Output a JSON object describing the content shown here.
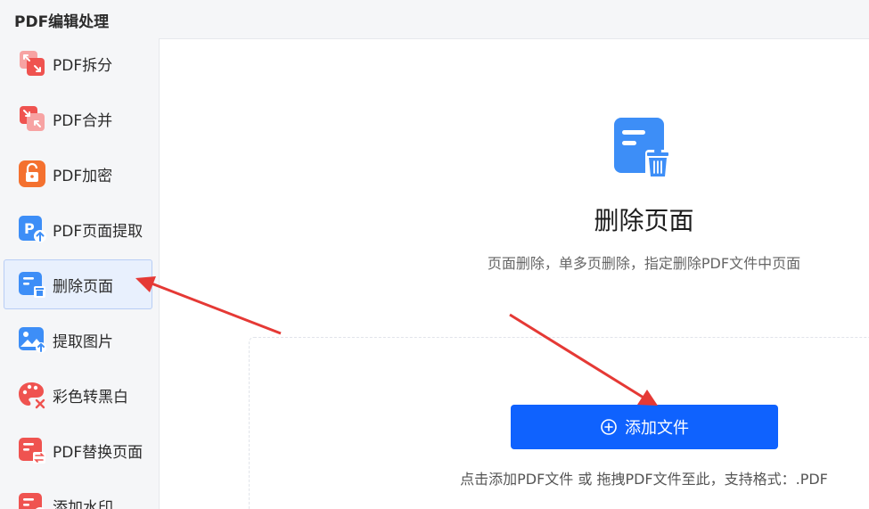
{
  "app": {
    "title": "PDF编辑处理"
  },
  "sidebar": {
    "items": [
      {
        "label": "PDF拆分",
        "icon": "split-icon",
        "color": "#ef5350"
      },
      {
        "label": "PDF合并",
        "icon": "merge-icon",
        "color": "#ef5350"
      },
      {
        "label": "PDF加密",
        "icon": "lock-icon",
        "color": "#f4712f"
      },
      {
        "label": "PDF页面提取",
        "icon": "page-extract-icon",
        "color": "#3d8ef7"
      },
      {
        "label": "删除页面",
        "icon": "delete-page-icon",
        "color": "#3d8ef7",
        "active": true
      },
      {
        "label": "提取图片",
        "icon": "image-extract-icon",
        "color": "#3d8ef7"
      },
      {
        "label": "彩色转黑白",
        "icon": "palette-icon",
        "color": "#ef5350"
      },
      {
        "label": "PDF替换页面",
        "icon": "replace-page-icon",
        "color": "#ef5350"
      },
      {
        "label": "添加水印",
        "icon": "watermark-icon",
        "color": "#ef5350"
      }
    ]
  },
  "main": {
    "title": "删除页面",
    "description": "页面删除，单多页删除，指定删除PDF文件中页面",
    "add_button": "添加文件",
    "hint": "点击添加PDF文件 或 拖拽PDF文件至此，支持格式：.PDF"
  },
  "colors": {
    "primary": "#0f62fe",
    "accent_red": "#e53935",
    "icon_blue": "#3d8ef7"
  }
}
